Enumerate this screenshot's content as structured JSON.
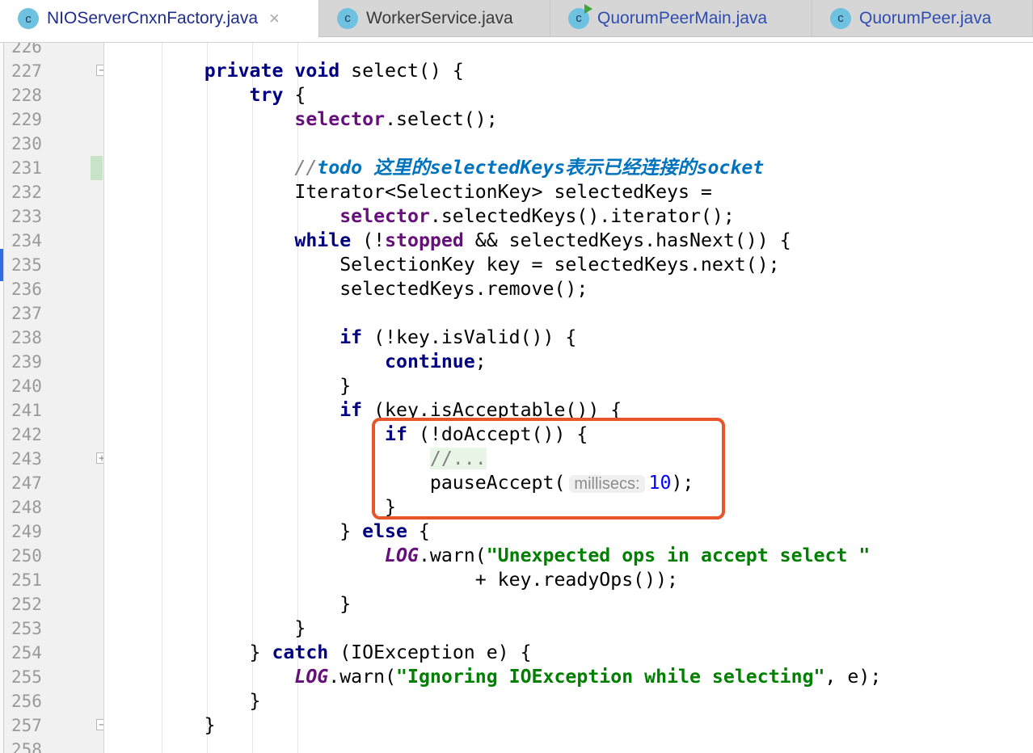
{
  "tabs": [
    {
      "label": "NIOServerCnxnFactory.java",
      "icon": "class-icon",
      "active": true,
      "color": "#1f2d8a"
    },
    {
      "label": "WorkerService.java",
      "icon": "class-icon",
      "active": false,
      "color": "#3a3a3a"
    },
    {
      "label": "QuorumPeerMain.java",
      "icon": "runnable-class-icon",
      "active": false,
      "color": "#2f4db0"
    },
    {
      "label": "QuorumPeer.java",
      "icon": "class-icon",
      "active": false,
      "color": "#2f4db0"
    }
  ],
  "close_glyph": "×",
  "class_glyph": "c",
  "line_numbers": [
    "226",
    "227",
    "228",
    "229",
    "230",
    "231",
    "232",
    "233",
    "234",
    "235",
    "236",
    "237",
    "238",
    "239",
    "240",
    "241",
    "242",
    "243",
    "247",
    "248",
    "249",
    "250",
    "251",
    "252",
    "253",
    "254",
    "255",
    "256",
    "257",
    "258"
  ],
  "code": [
    [],
    [
      [
        "p",
        "        "
      ],
      [
        "kw",
        "private void"
      ],
      [
        "p",
        " select() {"
      ]
    ],
    [
      [
        "p",
        "            "
      ],
      [
        "kw",
        "try"
      ],
      [
        "p",
        " {"
      ]
    ],
    [
      [
        "p",
        "                "
      ],
      [
        "field",
        "selector"
      ],
      [
        "p",
        ".select();"
      ]
    ],
    [],
    [
      [
        "p",
        "                "
      ],
      [
        "cmt",
        "//"
      ],
      [
        "todo",
        "todo 这里的selectedKeys表示已经连接的socket"
      ]
    ],
    [
      [
        "p",
        "                Iterator<SelectionKey> selectedKeys ="
      ]
    ],
    [
      [
        "p",
        "                    "
      ],
      [
        "field",
        "selector"
      ],
      [
        "p",
        ".selectedKeys().iterator();"
      ]
    ],
    [
      [
        "p",
        "                "
      ],
      [
        "kw",
        "while"
      ],
      [
        "p",
        " (!"
      ],
      [
        "field",
        "stopped"
      ],
      [
        "p",
        " && selectedKeys.hasNext()) {"
      ]
    ],
    [
      [
        "p",
        "                    SelectionKey key = selectedKeys.next();"
      ]
    ],
    [
      [
        "p",
        "                    selectedKeys.remove();"
      ]
    ],
    [],
    [
      [
        "p",
        "                    "
      ],
      [
        "kw",
        "if"
      ],
      [
        "p",
        " (!key.isValid()) {"
      ]
    ],
    [
      [
        "p",
        "                        "
      ],
      [
        "kw",
        "continue"
      ],
      [
        "p",
        ";"
      ]
    ],
    [
      [
        "p",
        "                    }"
      ]
    ],
    [
      [
        "p",
        "                    "
      ],
      [
        "kw",
        "if"
      ],
      [
        "p",
        " (key.isAcceptable()) {"
      ]
    ],
    [
      [
        "p",
        "                        "
      ],
      [
        "kw",
        "if"
      ],
      [
        "p",
        " (!doAccept()) {"
      ]
    ],
    [
      [
        "p",
        "                            "
      ],
      [
        "fcmt",
        "//..."
      ]
    ],
    [
      [
        "p",
        "                            pauseAccept("
      ],
      [
        "hint",
        "millisecs:"
      ],
      [
        "num",
        "10"
      ],
      [
        "p",
        ");"
      ]
    ],
    [
      [
        "p",
        "                        }"
      ]
    ],
    [
      [
        "p",
        "                    } "
      ],
      [
        "kw",
        "else"
      ],
      [
        "p",
        " {"
      ]
    ],
    [
      [
        "p",
        "                        "
      ],
      [
        "static",
        "LOG"
      ],
      [
        "p",
        ".warn("
      ],
      [
        "str",
        "\"Unexpected ops in accept select \""
      ]
    ],
    [
      [
        "p",
        "                                + key.readyOps());"
      ]
    ],
    [
      [
        "p",
        "                    }"
      ]
    ],
    [
      [
        "p",
        "                }"
      ]
    ],
    [
      [
        "p",
        "            } "
      ],
      [
        "kw",
        "catch"
      ],
      [
        "p",
        " (IOException e) {"
      ]
    ],
    [
      [
        "p",
        "                "
      ],
      [
        "static",
        "LOG"
      ],
      [
        "p",
        ".warn("
      ],
      [
        "str",
        "\"Ignoring IOException while selecting\""
      ],
      [
        "p",
        ", e);"
      ]
    ],
    [
      [
        "p",
        "            }"
      ]
    ],
    [
      [
        "p",
        "        }"
      ]
    ],
    []
  ],
  "gutter_markers": {
    "1": "fold-open",
    "5": "changed",
    "17": "fold-collapsed",
    "28": "fold-close"
  },
  "highlight_color": "#e8552a"
}
